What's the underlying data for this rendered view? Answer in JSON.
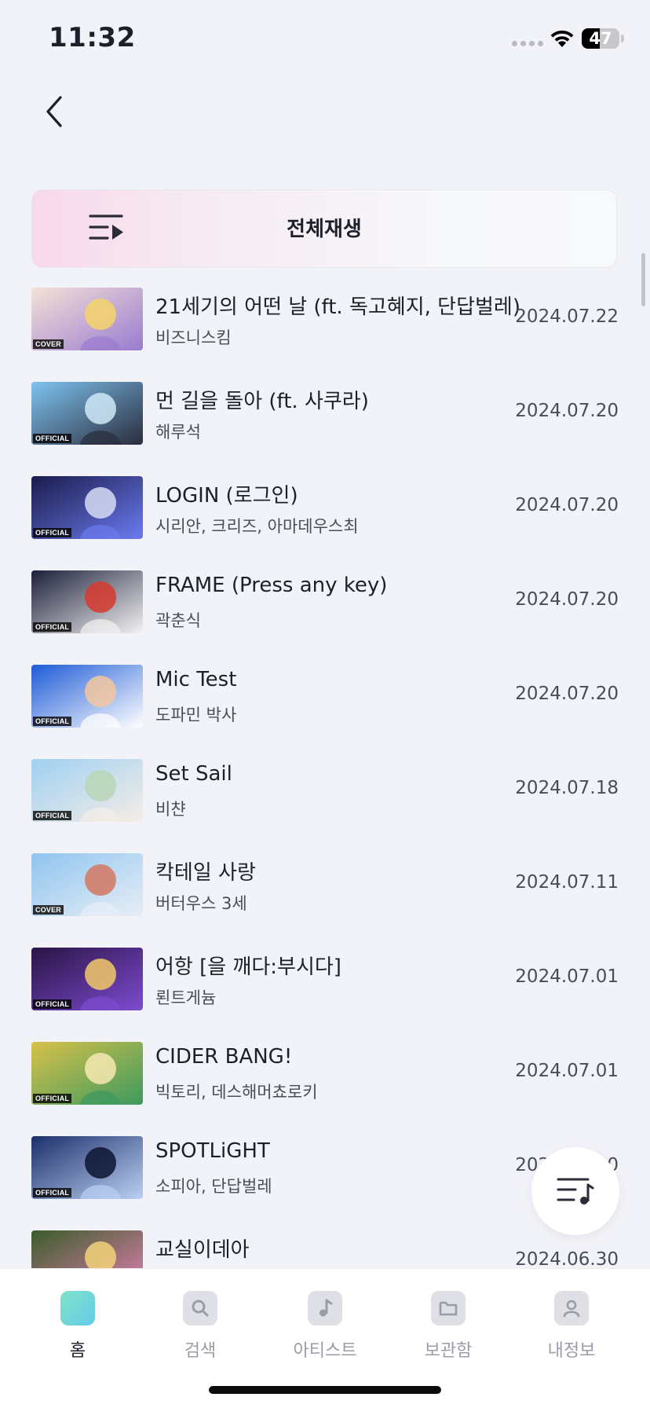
{
  "status_bar": {
    "time": "11:32",
    "battery": "47",
    "battery_level": 0.47
  },
  "header": {
    "back_icon": "chevron-left-icon"
  },
  "play_all": {
    "label": "전체재생",
    "icon": "playlist-play-icon"
  },
  "songs": [
    {
      "title": "21세기의 어떤 날 (ft. 독고혜지, 단답벌레)",
      "artist": "비즈니스킴",
      "date": "2024.07.22",
      "badge": "COVER",
      "thumb_colors": [
        "#f3e2d7",
        "#9a7bd0",
        "#f6d36b"
      ]
    },
    {
      "title": "먼 길을 돌아 (ft. 사쿠라)",
      "artist": "해루석",
      "date": "2024.07.20",
      "badge": "OFFICIAL",
      "thumb_colors": [
        "#7ec3f0",
        "#2a2c3c",
        "#cfe9f7"
      ]
    },
    {
      "title": "LOGIN (로그인)",
      "artist": "시리안, 크리즈, 아마데우스최",
      "date": "2024.07.20",
      "badge": "OFFICIAL",
      "thumb_colors": [
        "#1a1b4a",
        "#6b7bf0",
        "#d7dcf5"
      ]
    },
    {
      "title": "FRAME (Press any key)",
      "artist": "곽춘식",
      "date": "2024.07.20",
      "badge": "OFFICIAL",
      "thumb_colors": [
        "#1c1f3a",
        "#f3f3f3",
        "#d6392e"
      ]
    },
    {
      "title": "Mic Test",
      "artist": "도파민 박사",
      "date": "2024.07.20",
      "badge": "OFFICIAL",
      "thumb_colors": [
        "#1d5bd6",
        "#ffffff",
        "#f3c7a0"
      ]
    },
    {
      "title": "Set Sail",
      "artist": "비챤",
      "date": "2024.07.18",
      "badge": "OFFICIAL",
      "thumb_colors": [
        "#9fd0f2",
        "#f5ede6",
        "#b9d6b6"
      ]
    },
    {
      "title": "칵테일 사랑",
      "artist": "버터우스 3세",
      "date": "2024.07.11",
      "badge": "COVER",
      "thumb_colors": [
        "#8fc4ef",
        "#e8eef6",
        "#d27860"
      ]
    },
    {
      "title": "어항 [을 깨다:부시다]",
      "artist": "뢴트게늄",
      "date": "2024.07.01",
      "badge": "OFFICIAL",
      "thumb_colors": [
        "#2a1445",
        "#7d4bd1",
        "#f2c96a"
      ]
    },
    {
      "title": "CIDER BANG!",
      "artist": "빅토리, 데스해머쵸로키",
      "date": "2024.07.01",
      "badge": "OFFICIAL",
      "thumb_colors": [
        "#d8c14a",
        "#3c9a5f",
        "#f6e9b2"
      ]
    },
    {
      "title": "SPOTLiGHT",
      "artist": "소피아, 단답벌레",
      "date": "2024.06.30",
      "badge": "OFFICIAL",
      "thumb_colors": [
        "#1b2f6b",
        "#bcd0f3",
        "#0d1430"
      ]
    },
    {
      "title": "교실이데아",
      "artist": "",
      "date": "2024.06.30",
      "badge": "",
      "thumb_colors": [
        "#3b5c2a",
        "#e27fb1",
        "#f2d27a"
      ]
    }
  ],
  "floating_button": {
    "icon": "music-playlist-icon"
  },
  "tabs": [
    {
      "label": "홈",
      "icon": "home-icon",
      "active": true
    },
    {
      "label": "검색",
      "icon": "search-icon",
      "active": false
    },
    {
      "label": "아티스트",
      "icon": "music-note-icon",
      "active": false
    },
    {
      "label": "보관함",
      "icon": "folder-icon",
      "active": false
    },
    {
      "label": "내정보",
      "icon": "person-icon",
      "active": false
    }
  ],
  "colors": {
    "background": "#f2f3f8",
    "accent_gradient": [
      "#7fe3c8",
      "#66cbe8"
    ],
    "text": "#1d1f2a"
  }
}
